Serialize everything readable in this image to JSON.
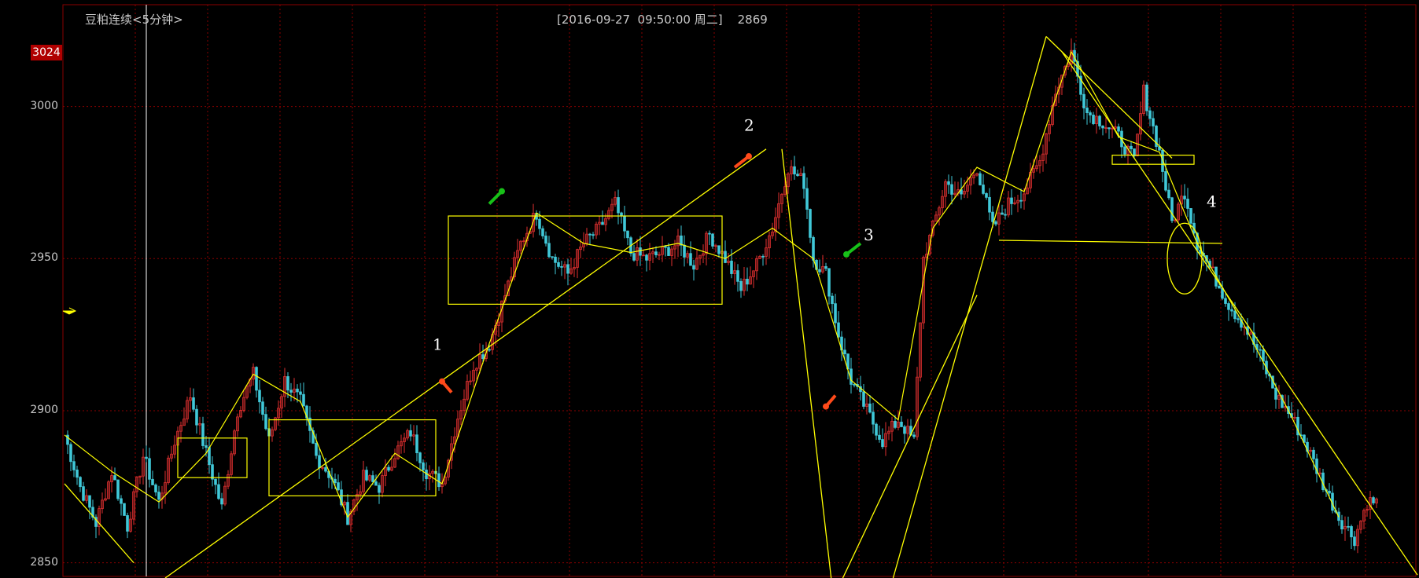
{
  "header": {
    "title": "豆粕连续<5分钟>",
    "info": "[2016-09-27  09:50:00 周二]    2869"
  },
  "colors": {
    "background": "#000000",
    "grid": "#8a0000",
    "axis_text": "#c8c8c8",
    "up_candle": "#e03030",
    "down_candle": "#40c8d8",
    "drawing": "#ffff00",
    "badge": "#b00000",
    "arrow_red": "#ff4a1a",
    "arrow_green": "#18c018"
  },
  "chart_data": {
    "type": "candlestick",
    "title": "",
    "xlabel": "",
    "ylabel": "",
    "ylim": [
      2845,
      3035
    ],
    "y_ticks": [
      2850,
      2900,
      2950,
      3000
    ],
    "highlight_price": "3024",
    "current_price": 2869,
    "path_points": [
      [
        0,
        2892
      ],
      [
        5,
        2875
      ],
      [
        10,
        2863
      ],
      [
        15,
        2880
      ],
      [
        20,
        2862
      ],
      [
        25,
        2885
      ],
      [
        30,
        2870
      ],
      [
        35,
        2890
      ],
      [
        40,
        2905
      ],
      [
        45,
        2886
      ],
      [
        50,
        2868
      ],
      [
        55,
        2900
      ],
      [
        60,
        2912
      ],
      [
        65,
        2890
      ],
      [
        70,
        2910
      ],
      [
        75,
        2903
      ],
      [
        80,
        2885
      ],
      [
        85,
        2878
      ],
      [
        90,
        2865
      ],
      [
        95,
        2878
      ],
      [
        100,
        2875
      ],
      [
        105,
        2886
      ],
      [
        110,
        2893
      ],
      [
        115,
        2880
      ],
      [
        120,
        2876
      ],
      [
        125,
        2898
      ],
      [
        130,
        2915
      ],
      [
        135,
        2922
      ],
      [
        140,
        2938
      ],
      [
        145,
        2955
      ],
      [
        150,
        2965
      ],
      [
        155,
        2950
      ],
      [
        160,
        2945
      ],
      [
        165,
        2955
      ],
      [
        170,
        2960
      ],
      [
        175,
        2968
      ],
      [
        180,
        2952
      ],
      [
        185,
        2950
      ],
      [
        190,
        2952
      ],
      [
        195,
        2955
      ],
      [
        200,
        2948
      ],
      [
        205,
        2958
      ],
      [
        210,
        2950
      ],
      [
        215,
        2940
      ],
      [
        220,
        2948
      ],
      [
        225,
        2960
      ],
      [
        230,
        2980
      ],
      [
        235,
        2975
      ],
      [
        238,
        2950
      ],
      [
        242,
        2945
      ],
      [
        246,
        2925
      ],
      [
        250,
        2910
      ],
      [
        255,
        2900
      ],
      [
        260,
        2890
      ],
      [
        265,
        2897
      ],
      [
        270,
        2890
      ],
      [
        273,
        2950
      ],
      [
        276,
        2960
      ],
      [
        280,
        2975
      ],
      [
        285,
        2970
      ],
      [
        290,
        2980
      ],
      [
        295,
        2960
      ],
      [
        300,
        2968
      ],
      [
        305,
        2972
      ],
      [
        310,
        2982
      ],
      [
        315,
        3005
      ],
      [
        320,
        3018
      ],
      [
        325,
        2998
      ],
      [
        330,
        2995
      ],
      [
        335,
        2990
      ],
      [
        340,
        2982
      ],
      [
        343,
        3005
      ],
      [
        348,
        2985
      ],
      [
        352,
        2962
      ],
      [
        356,
        2972
      ],
      [
        360,
        2955
      ],
      [
        365,
        2945
      ],
      [
        370,
        2935
      ],
      [
        375,
        2928
      ],
      [
        380,
        2918
      ],
      [
        385,
        2905
      ],
      [
        390,
        2898
      ],
      [
        395,
        2888
      ],
      [
        400,
        2876
      ],
      [
        405,
        2865
      ],
      [
        410,
        2858
      ],
      [
        414,
        2870
      ]
    ],
    "annotations": [
      {
        "label": "1",
        "x": 117,
        "y": 2920
      },
      {
        "label": "2",
        "x": 216,
        "y": 2992
      },
      {
        "label": "3",
        "x": 254,
        "y": 2956
      },
      {
        "label": "4",
        "x": 363,
        "y": 2967
      }
    ],
    "zones": [
      {
        "x0": 36,
        "x1": 58,
        "y0": 2878,
        "y1": 2891
      },
      {
        "x0": 65,
        "x1": 118,
        "y0": 2872,
        "y1": 2897
      },
      {
        "x0": 122,
        "x1": 209,
        "y0": 2935,
        "y1": 2964
      },
      {
        "x0": 333,
        "x1": 359,
        "y0": 2981,
        "y1": 2984
      }
    ],
    "trend_lines": [
      [
        0,
        2876,
        22,
        2850
      ],
      [
        32,
        2845,
        223,
        2986
      ],
      [
        246,
        2842,
        290,
        2938
      ],
      [
        244,
        2842,
        228,
        2986
      ],
      [
        262,
        2840,
        312,
        3023
      ],
      [
        312,
        3023,
        352,
        2983
      ],
      [
        317,
        3018,
        430,
        2846
      ],
      [
        297,
        2956,
        368,
        2955
      ]
    ]
  }
}
